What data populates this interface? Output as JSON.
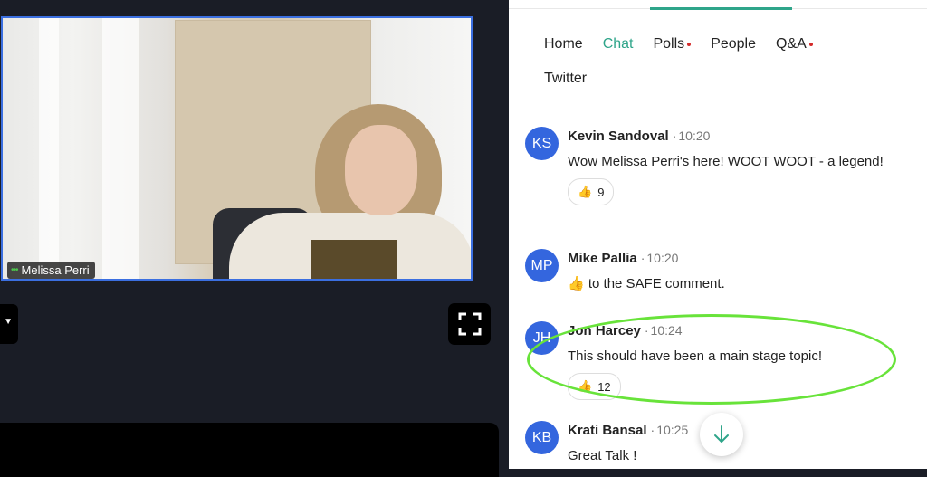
{
  "video": {
    "participant_name": "Melissa Perri"
  },
  "chat_panel": {
    "tabs_row1": [
      {
        "label": "Home",
        "active": false,
        "notify": false
      },
      {
        "label": "Chat",
        "active": true,
        "notify": false
      },
      {
        "label": "Polls",
        "active": false,
        "notify": true
      },
      {
        "label": "People",
        "active": false,
        "notify": false
      },
      {
        "label": "Q&A",
        "active": false,
        "notify": true
      }
    ],
    "tabs_row2": [
      {
        "label": "Twitter",
        "active": false,
        "notify": false
      }
    ],
    "messages": [
      {
        "initials": "KS",
        "author": "Kevin Sandoval",
        "time": "10:20",
        "text": "Wow Melissa Perri's here! WOOT WOOT - a legend!",
        "reaction_count": "9"
      },
      {
        "initials": "MP",
        "author": "Mike Pallia",
        "time": "10:20",
        "text": "👍 to the SAFE comment.",
        "reaction_count": null
      },
      {
        "initials": "JH",
        "author": "Jon Harcey",
        "time": "10:24",
        "text": "This should have been a main stage topic!",
        "reaction_count": "12"
      },
      {
        "initials": "KB",
        "author": "Krati Bansal",
        "time": "10:25",
        "text": "Great Talk !",
        "reaction_count": null
      }
    ]
  },
  "colors": {
    "accent": "#2fa58a",
    "avatar": "#3466de",
    "highlight": "#68e33a",
    "notify_dot": "#d42a2a"
  }
}
